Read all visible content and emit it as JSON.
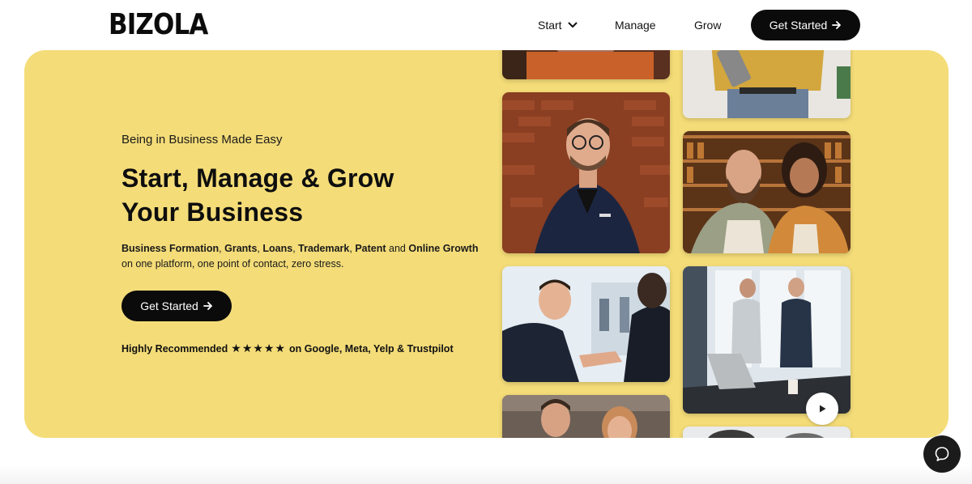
{
  "brand": {
    "logo_text": "BIZOLA"
  },
  "nav": {
    "start_label": "Start",
    "manage_label": "Manage",
    "grow_label": "Grow",
    "cta_label": "Get Started"
  },
  "hero": {
    "eyebrow": "Being in Business Made Easy",
    "headline_line1": "Start, Manage & Grow",
    "headline_line2": "Your Business",
    "services": {
      "s1": "Business Formation",
      "sep1": ", ",
      "s2": "Grants",
      "sep2": ", ",
      "s3": "Loans",
      "sep3": ", ",
      "s4": "Trademark",
      "sep4": ", ",
      "s5": "Patent",
      "sep5": " and ",
      "s6": "Online Growth"
    },
    "tagline": "on one platform, one point of contact, zero stress.",
    "cta_label": "Get Started",
    "recommend_prefix": "Highly Recommended",
    "stars": "★★★★★",
    "recommend_suffix": "on Google, Meta, Yelp & Trustpilot"
  },
  "icons": {
    "chevron": "chevron-down-icon",
    "arrow": "arrow-right-icon",
    "play": "play-icon",
    "chat": "chat-icon"
  },
  "colors": {
    "hero_bg": "#f4dc78",
    "button_bg": "#0b0b0b",
    "button_text": "#ffffff"
  }
}
